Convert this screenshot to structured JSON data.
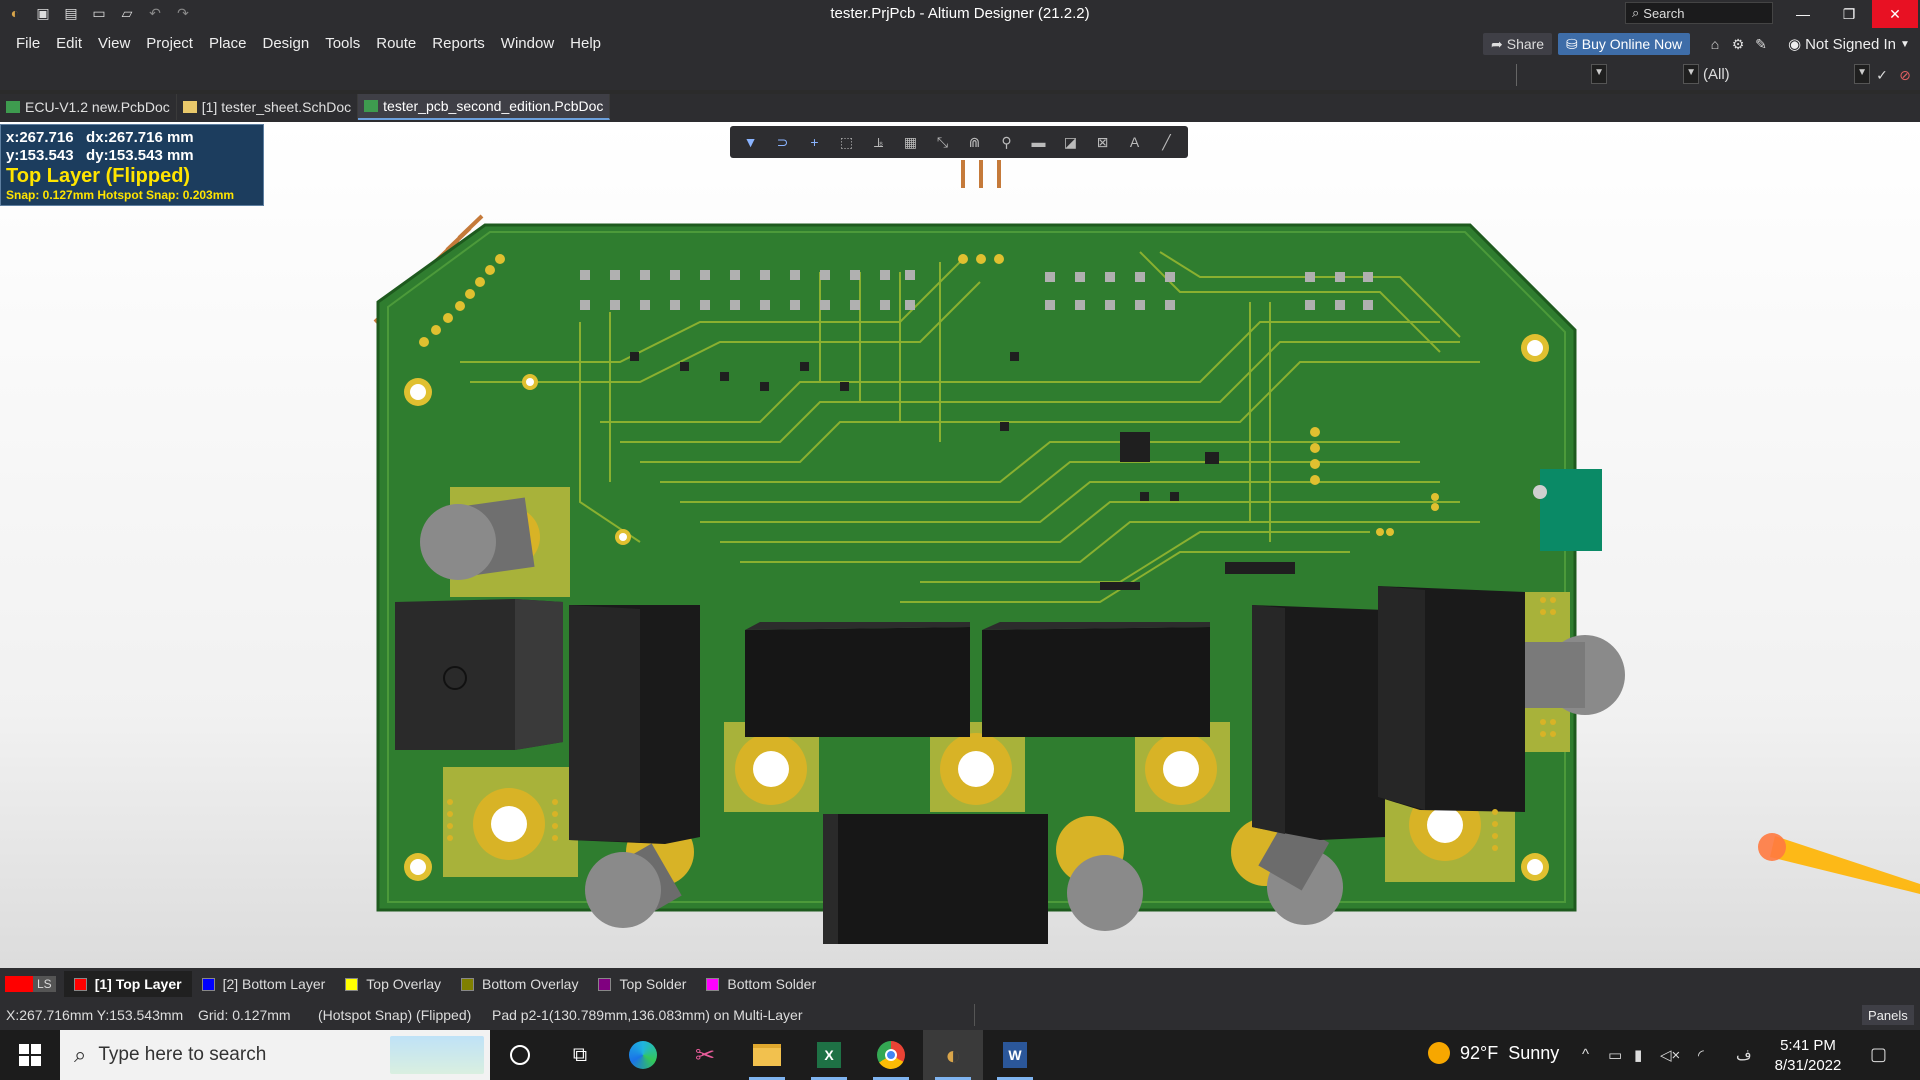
{
  "titlebar": {
    "title": "tester.PrjPcb - Altium Designer (21.2.2)",
    "search_label": "Search",
    "icons": [
      "altium-logo-icon",
      "save-icon",
      "save-all-icon",
      "open-icon",
      "open-project-icon",
      "undo-icon",
      "redo-icon"
    ]
  },
  "menubar": {
    "items": [
      "File",
      "Edit",
      "View",
      "Project",
      "Place",
      "Design",
      "Tools",
      "Route",
      "Reports",
      "Window",
      "Help"
    ],
    "share_label": "Share",
    "buy_label": "Buy Online Now",
    "signed_in_label": "Not Signed In"
  },
  "toolrow": {
    "filter_value": "(All)"
  },
  "doc_tabs": [
    {
      "label": "ECU-V1.2 new.PcbDoc",
      "type": "pcb",
      "active": false
    },
    {
      "label": "[1] tester_sheet.SchDoc",
      "type": "sch",
      "active": false
    },
    {
      "label": "tester_pcb_second_edition.PcbDoc",
      "type": "pcb",
      "active": true
    }
  ],
  "hud": {
    "line1": "x:267.716   dx:267.716 mm",
    "line2": "y:153.543   dy:153.543 mm",
    "layer": "Top Layer (Flipped)",
    "snap": "Snap: 0.127mm Hotspot Snap: 0.203mm"
  },
  "layers": {
    "ls_label": "LS",
    "tabs": [
      {
        "label": "[1] Top Layer",
        "color": "#ff0000",
        "active": true
      },
      {
        "label": "[2] Bottom Layer",
        "color": "#0000ff",
        "active": false
      },
      {
        "label": "Top Overlay",
        "color": "#ffff00",
        "active": false
      },
      {
        "label": "Bottom Overlay",
        "color": "#808000",
        "active": false
      },
      {
        "label": "Top Solder",
        "color": "#800080",
        "active": false
      },
      {
        "label": "Bottom Solder",
        "color": "#ff00ff",
        "active": false
      }
    ]
  },
  "status": {
    "coords": "X:267.716mm Y:153.543mm",
    "grid": "Grid: 0.127mm",
    "snap": "(Hotspot Snap) (Flipped)",
    "pad": "Pad p2-1(130.789mm,136.083mm) on Multi-Layer",
    "panels": "Panels"
  },
  "taskbar": {
    "search_placeholder": "Type here to search",
    "weather_temp": "92°F",
    "weather_text": "Sunny",
    "lang": "ف",
    "time": "5:41 PM",
    "date": "8/31/2022"
  },
  "colors": {
    "pcb_green": "#2f7d2f",
    "trace": "#9cbc38",
    "gold": "#d8b326",
    "component_black": "#1c1c1c"
  }
}
